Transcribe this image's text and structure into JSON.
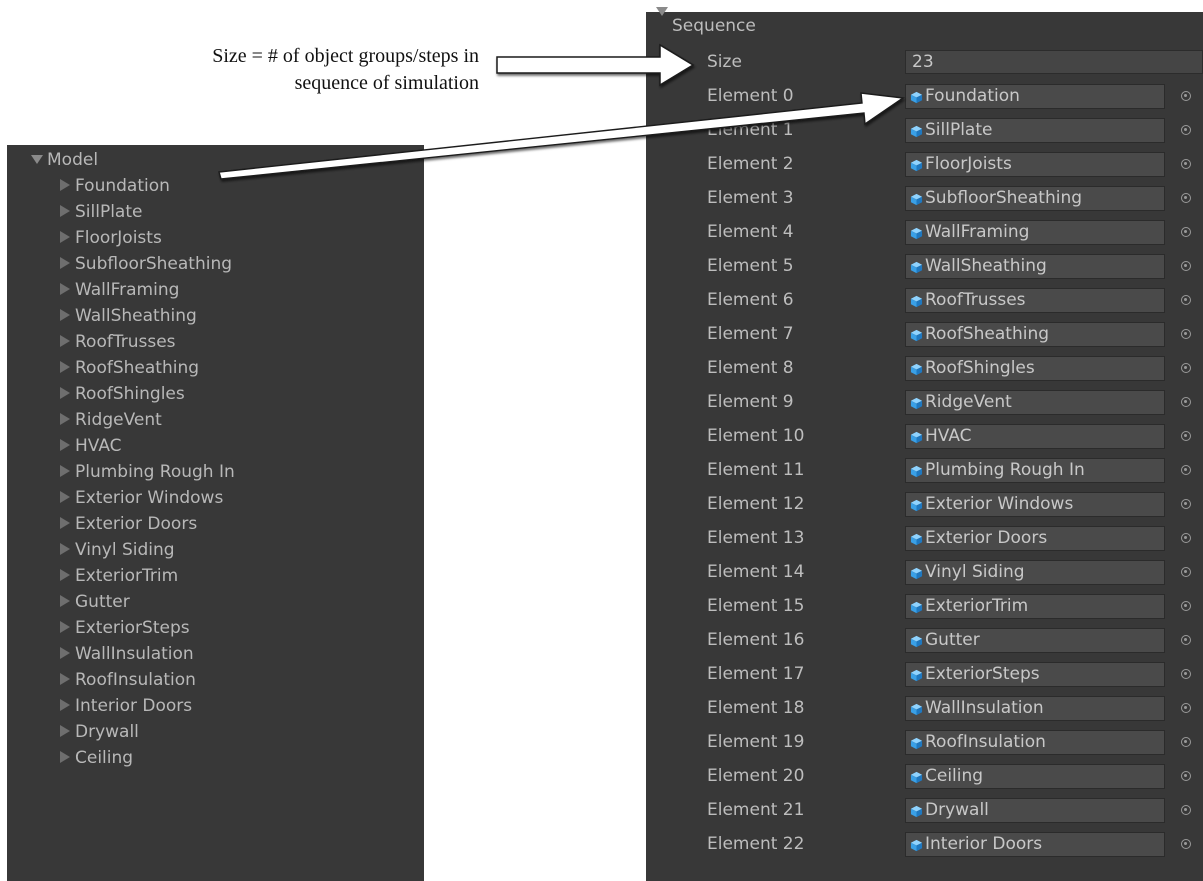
{
  "annotation": {
    "line1": "Size = # of object groups/steps in",
    "line2": "sequence of simulation"
  },
  "model": {
    "title": "Model",
    "children": [
      "Foundation",
      "SillPlate",
      "FloorJoists",
      "SubfloorSheathing",
      "WallFraming",
      "WallSheathing",
      "RoofTrusses",
      "RoofSheathing",
      "RoofShingles",
      "RidgeVent",
      "HVAC",
      "Plumbing Rough In",
      "Exterior Windows",
      "Exterior Doors",
      "Vinyl Siding",
      "ExteriorTrim",
      "Gutter",
      "ExteriorSteps",
      "WallInsulation",
      "RoofInsulation",
      "Interior Doors",
      "Drywall",
      "Ceiling"
    ]
  },
  "sequence": {
    "title": "Sequence",
    "size_label": "Size",
    "size_value": "23",
    "elements": [
      {
        "label": "Element 0",
        "value": "Foundation"
      },
      {
        "label": "Element 1",
        "value": "SillPlate"
      },
      {
        "label": "Element 2",
        "value": "FloorJoists"
      },
      {
        "label": "Element 3",
        "value": "SubfloorSheathing"
      },
      {
        "label": "Element 4",
        "value": "WallFraming"
      },
      {
        "label": "Element 5",
        "value": "WallSheathing"
      },
      {
        "label": "Element 6",
        "value": "RoofTrusses"
      },
      {
        "label": "Element 7",
        "value": "RoofSheathing"
      },
      {
        "label": "Element 8",
        "value": "RoofShingles"
      },
      {
        "label": "Element 9",
        "value": "RidgeVent"
      },
      {
        "label": "Element 10",
        "value": "HVAC"
      },
      {
        "label": "Element 11",
        "value": "Plumbing Rough In"
      },
      {
        "label": "Element 12",
        "value": "Exterior Windows"
      },
      {
        "label": "Element 13",
        "value": "Exterior Doors"
      },
      {
        "label": "Element 14",
        "value": "Vinyl Siding"
      },
      {
        "label": "Element 15",
        "value": "ExteriorTrim"
      },
      {
        "label": "Element 16",
        "value": "Gutter"
      },
      {
        "label": "Element 17",
        "value": "ExteriorSteps"
      },
      {
        "label": "Element 18",
        "value": "WallInsulation"
      },
      {
        "label": "Element 19",
        "value": "RoofInsulation"
      },
      {
        "label": "Element 20",
        "value": "Ceiling"
      },
      {
        "label": "Element 21",
        "value": "Drywall"
      },
      {
        "label": "Element 22",
        "value": "Interior Doors"
      }
    ]
  },
  "icons": {
    "object_field": "cube-icon",
    "picker": "object-picker-icon",
    "expanded": "triangle-down-icon",
    "collapsed": "triangle-right-icon"
  },
  "colors": {
    "panel_bg": "#383838",
    "field_bg": "#4a4a4a",
    "text": "#bdbdbd",
    "cube_blue": "#3aa0e6"
  }
}
